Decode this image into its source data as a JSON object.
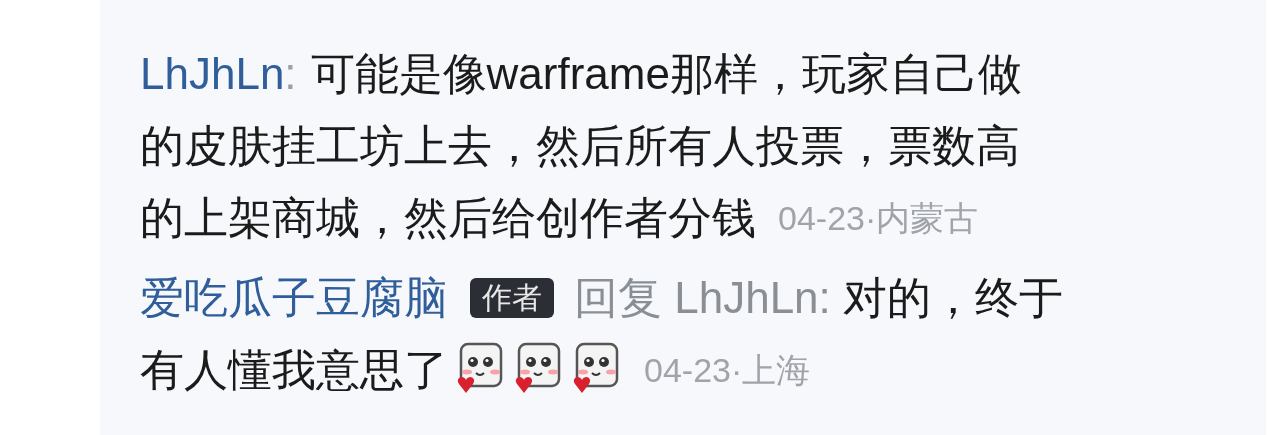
{
  "comments": [
    {
      "author": "LhJhLn",
      "separator": ":",
      "text_lines": [
        "可能是像warframe那样，玩家自己做",
        "的皮肤挂工坊上去，然后所有人投票，票数高",
        "的上架商城，然后给创作者分钱"
      ],
      "meta": "04-23·内蒙古"
    },
    {
      "author": "爱吃瓜子豆腐脑",
      "badge": "作者",
      "reply_label": "回复 LhJhLn:",
      "text_lines": [
        "对的，终于",
        "有人懂我意思了"
      ],
      "emojis": [
        {
          "kind": "sticker"
        },
        {
          "kind": "sticker"
        },
        {
          "kind": "sticker"
        }
      ],
      "meta": "04-23·上海"
    }
  ]
}
